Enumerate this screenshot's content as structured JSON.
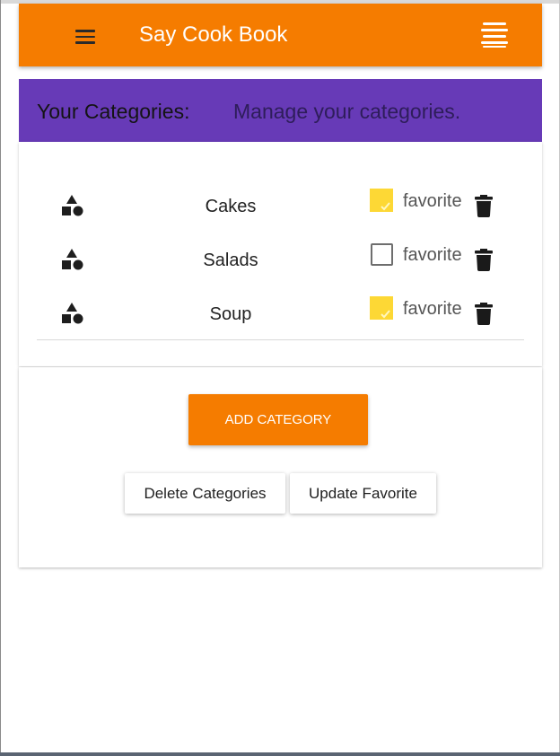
{
  "app": {
    "title": "Say Cook Book",
    "accent_color": "#f57c00",
    "header_color": "#673ab7"
  },
  "toolbar": {
    "menu_icon": "menu-icon",
    "stack_icon": "stack-icon"
  },
  "header": {
    "title": "Your Categories:",
    "subtitle": "Manage your categories."
  },
  "categories": [
    {
      "name": "Cakes",
      "favorite": true,
      "favorite_label": "favorite"
    },
    {
      "name": "Salads",
      "favorite": false,
      "favorite_label": "favorite"
    },
    {
      "name": "Soup",
      "favorite": true,
      "favorite_label": "favorite"
    }
  ],
  "actions": {
    "add_label": "ADD CATEGORY",
    "delete_label": "Delete Categories",
    "update_label": "Update Favorite"
  }
}
